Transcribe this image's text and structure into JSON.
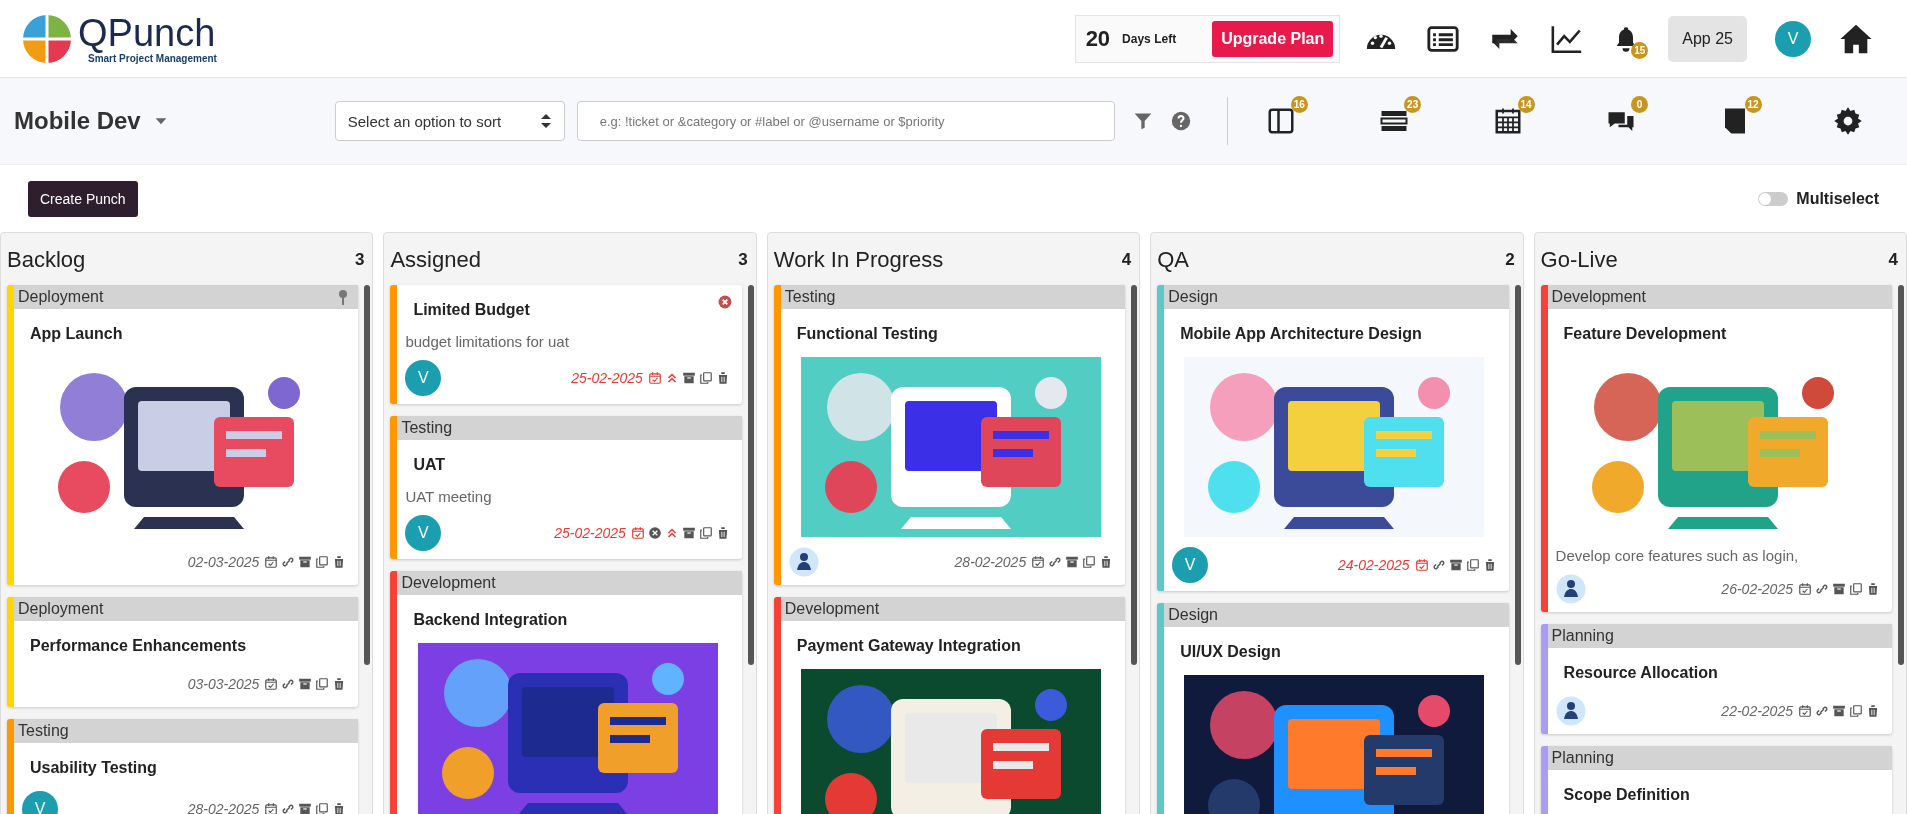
{
  "brand": {
    "name": "QPunch",
    "tagline": "Smart Project Management"
  },
  "trial": {
    "days": "20",
    "label": "Days Left",
    "button": "Upgrade Plan"
  },
  "top_nav": {
    "notifications_badge": "15",
    "app_label": "App 25",
    "user_initial": "V"
  },
  "board": {
    "title": "Mobile Dev",
    "sort_placeholder": "Select an option to sort",
    "search_placeholder": "e.g: !ticket or &category or #label or @username or $priority",
    "view_badges": [
      "16",
      "23",
      "14",
      "0",
      "12"
    ]
  },
  "create_button": "Create Punch",
  "multiselect": {
    "label": "Multiselect",
    "on": false
  },
  "columns": [
    {
      "title": "Backlog",
      "count": "3",
      "cards": [
        {
          "category": "Deployment",
          "color": "#ffd600",
          "pinned": true,
          "title": "App Launch",
          "media": {
            "kind": "picture"
          },
          "date": "02-03-2025",
          "overdue": false,
          "actions": [
            {
              "kind": "calendar"
            },
            {
              "kind": "link"
            },
            {
              "kind": "archive"
            },
            {
              "kind": "copy"
            },
            {
              "kind": "trash"
            }
          ]
        },
        {
          "category": "Deployment",
          "color": "#ffd600",
          "pinned": false,
          "title": "Performance Enhancements",
          "date": "03-03-2025",
          "overdue": false,
          "actions": [
            {
              "kind": "calendar"
            },
            {
              "kind": "link"
            },
            {
              "kind": "archive"
            },
            {
              "kind": "copy"
            },
            {
              "kind": "trash"
            }
          ]
        },
        {
          "category": "Testing",
          "color": "#ff9800",
          "pinned": false,
          "title": "Usability Testing",
          "avatar": {
            "kind": "initial",
            "text": "V"
          },
          "date": "28-02-2025",
          "overdue": false,
          "actions": [
            {
              "kind": "calendar"
            },
            {
              "kind": "link"
            },
            {
              "kind": "archive"
            },
            {
              "kind": "copy"
            },
            {
              "kind": "trash"
            }
          ]
        }
      ]
    },
    {
      "title": "Assigned",
      "count": "3",
      "cards": [
        {
          "color": "#ff9800",
          "closable": true,
          "title": "Limited Budget",
          "description": "budget limitations for uat",
          "avatar": {
            "kind": "initial",
            "text": "V"
          },
          "date": "25-02-2025",
          "overdue": true,
          "actions": [
            {
              "kind": "calendar"
            },
            {
              "kind": "priority"
            },
            {
              "kind": "archive"
            },
            {
              "kind": "copy"
            },
            {
              "kind": "trash"
            }
          ]
        },
        {
          "category": "Testing",
          "color": "#ff9800",
          "title": "UAT",
          "description": "UAT meeting",
          "avatar": {
            "kind": "initial",
            "text": "V"
          },
          "date": "25-02-2025",
          "overdue": true,
          "actions": [
            {
              "kind": "calendar"
            },
            {
              "kind": "cancel"
            },
            {
              "kind": "priority"
            },
            {
              "kind": "archive"
            },
            {
              "kind": "copy"
            },
            {
              "kind": "trash"
            }
          ]
        },
        {
          "category": "Development",
          "color": "#f44336",
          "title": "Backend Integration",
          "media": {
            "kind": "picture"
          }
        }
      ]
    },
    {
      "title": "Work In Progress",
      "count": "4",
      "cards": [
        {
          "category": "Testing",
          "color": "#ff9800",
          "title": "Functional Testing",
          "media": {
            "kind": "picture"
          },
          "avatar": {
            "kind": "picture"
          },
          "date": "28-02-2025",
          "overdue": false,
          "actions": [
            {
              "kind": "calendar"
            },
            {
              "kind": "link"
            },
            {
              "kind": "archive"
            },
            {
              "kind": "copy"
            },
            {
              "kind": "trash"
            }
          ]
        },
        {
          "category": "Development",
          "color": "#f44336",
          "title": "Payment Gateway Integration",
          "media": {
            "kind": "picture"
          }
        }
      ]
    },
    {
      "title": "QA",
      "count": "2",
      "cards": [
        {
          "category": "Design",
          "color": "#5cc8c8",
          "title": "Mobile App Architecture Design",
          "media": {
            "kind": "picture"
          },
          "avatar": {
            "kind": "initial",
            "text": "V"
          },
          "date": "24-02-2025",
          "overdue": true,
          "actions": [
            {
              "kind": "calendar"
            },
            {
              "kind": "link"
            },
            {
              "kind": "archive"
            },
            {
              "kind": "copy"
            },
            {
              "kind": "trash"
            }
          ]
        },
        {
          "category": "Design",
          "color": "#5cc8c8",
          "title": "UI/UX Design",
          "media": {
            "kind": "picture"
          }
        }
      ]
    },
    {
      "title": "Go-Live",
      "count": "4",
      "cards": [
        {
          "category": "Development",
          "color": "#f44336",
          "title": "Feature Development",
          "media": {
            "kind": "picture"
          },
          "description": "Develop core features such as login,",
          "avatar": {
            "kind": "picture"
          },
          "date": "26-02-2025",
          "overdue": false,
          "actions": [
            {
              "kind": "calendar"
            },
            {
              "kind": "link"
            },
            {
              "kind": "archive"
            },
            {
              "kind": "copy"
            },
            {
              "kind": "trash"
            }
          ]
        },
        {
          "category": "Planning",
          "color": "#a99cf5",
          "title": "Resource Allocation",
          "avatar": {
            "kind": "picture"
          },
          "date": "22-02-2025",
          "overdue": false,
          "actions": [
            {
              "kind": "calendar"
            },
            {
              "kind": "link"
            },
            {
              "kind": "archive"
            },
            {
              "kind": "copy"
            },
            {
              "kind": "trash"
            }
          ]
        },
        {
          "category": "Planning",
          "color": "#a99cf5",
          "title": "Scope Definition"
        }
      ]
    }
  ]
}
